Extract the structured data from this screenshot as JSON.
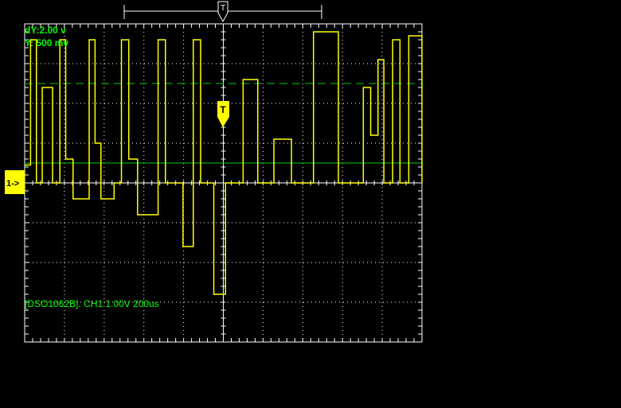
{
  "readouts": {
    "dy": "dY:2.00 v",
    "y": "Y:  500 mv",
    "status": "[DSO1062B]. CH1 1.00V 200us"
  },
  "markers": {
    "channel": "1->",
    "trigger": "T"
  },
  "colors": {
    "background": "#000000",
    "grid": "#ffffff",
    "trace": "#ffff00",
    "readout_text": "#00ff00",
    "cursor_line": "#00cc00"
  },
  "trace_levels": [
    {
      "t": 0.0,
      "v": 0.45
    },
    {
      "t": 0.04,
      "v": 3.6
    },
    {
      "t": 0.08,
      "v": 0.0
    },
    {
      "t": 0.12,
      "v": 2.4
    },
    {
      "t": 0.19,
      "v": 0.0
    },
    {
      "t": 0.24,
      "v": 3.6
    },
    {
      "t": 0.28,
      "v": 0.6
    },
    {
      "t": 0.33,
      "v": -0.4
    },
    {
      "t": 0.44,
      "v": 3.6
    },
    {
      "t": 0.48,
      "v": 1.0
    },
    {
      "t": 0.52,
      "v": -0.4
    },
    {
      "t": 0.61,
      "v": 0.0
    },
    {
      "t": 0.66,
      "v": 3.6
    },
    {
      "t": 0.71,
      "v": 0.6
    },
    {
      "t": 0.77,
      "v": -0.8
    },
    {
      "t": 0.91,
      "v": 3.6
    },
    {
      "t": 0.96,
      "v": 0.0
    },
    {
      "t": 1.08,
      "v": -1.6
    },
    {
      "t": 1.15,
      "v": 3.6
    },
    {
      "t": 1.2,
      "v": 0.0
    },
    {
      "t": 1.29,
      "v": -2.8
    },
    {
      "t": 1.37,
      "v": 0.0
    },
    {
      "t": 1.49,
      "v": 2.6
    },
    {
      "t": 1.59,
      "v": 0.0
    },
    {
      "t": 1.7,
      "v": 1.1
    },
    {
      "t": 1.82,
      "v": 0.0
    },
    {
      "t": 1.97,
      "v": 3.8
    },
    {
      "t": 2.14,
      "v": 0.0
    },
    {
      "t": 2.31,
      "v": 2.4
    },
    {
      "t": 2.36,
      "v": 1.2
    },
    {
      "t": 2.41,
      "v": 3.1
    },
    {
      "t": 2.45,
      "v": 0.0
    },
    {
      "t": 2.51,
      "v": 3.6
    },
    {
      "t": 2.56,
      "v": 0.0
    },
    {
      "t": 2.62,
      "v": 3.7
    },
    {
      "t": 2.71,
      "v": 0.0
    }
  ]
}
